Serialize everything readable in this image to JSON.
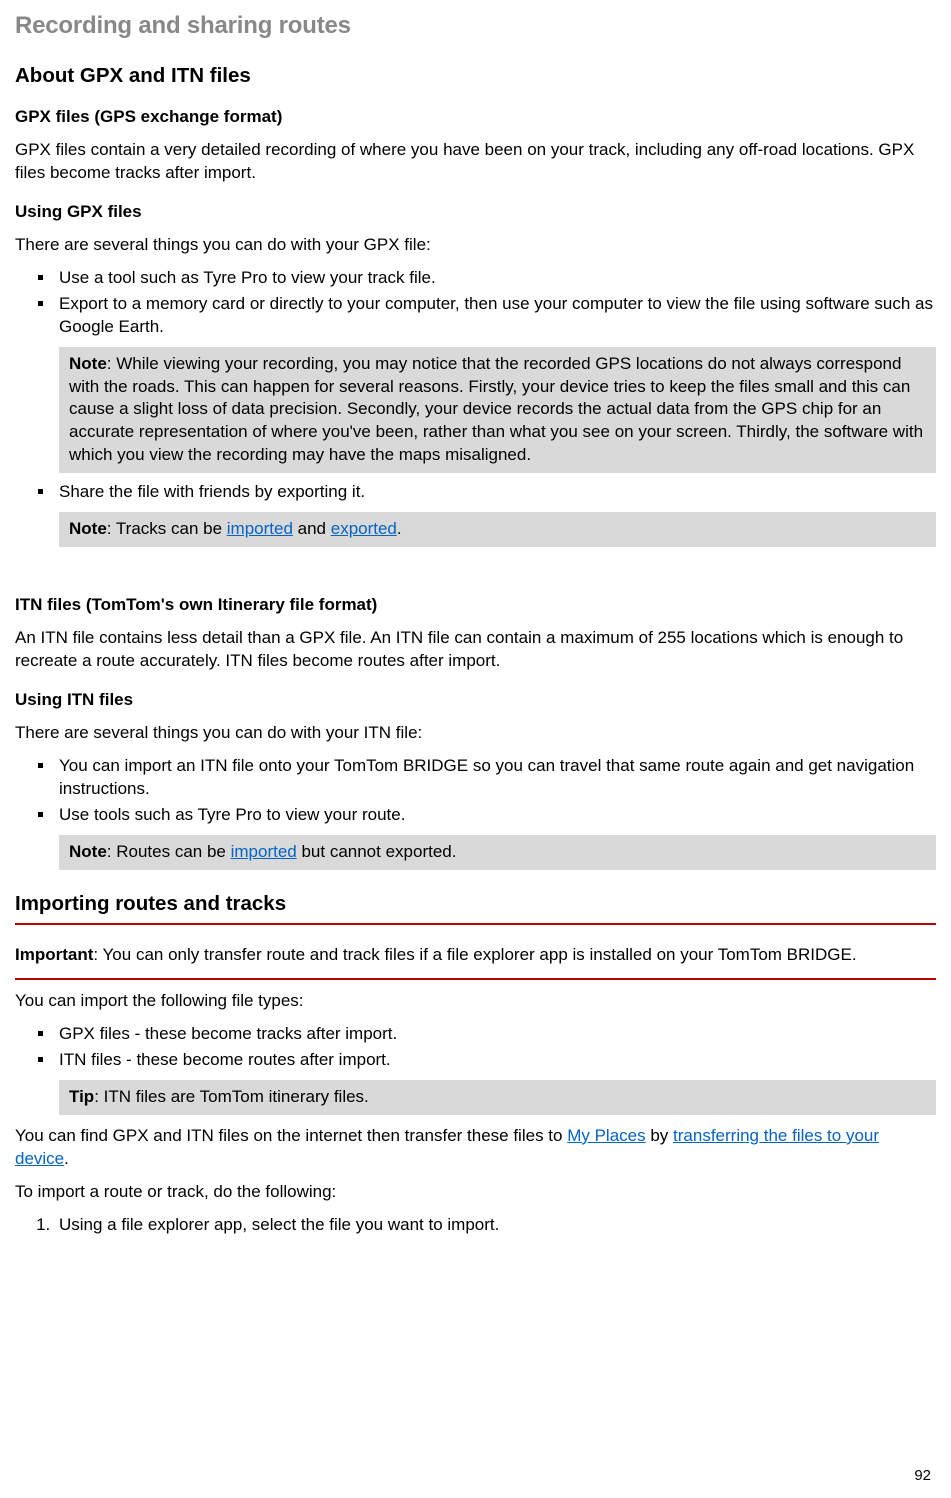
{
  "pageTitle": "Recording and sharing routes",
  "h2_about": "About GPX and ITN files",
  "gpx": {
    "heading": "GPX files (GPS exchange format)",
    "desc": "GPX files contain a very detailed recording of where you have been on your track, including any off-road locations. GPX files become tracks after import.",
    "using_h": "Using GPX files",
    "using_intro": "There are several things you can do with your GPX file:",
    "bullets": {
      "b1": "Use a tool such as Tyre Pro to view your track file.",
      "b2": "Export to a memory card or directly to your computer, then use your computer to view the file using software such as Google Earth.",
      "b3": "Share the file with friends by exporting it."
    },
    "note1_label": "Note",
    "note1_body": ": While viewing your recording, you may notice that the recorded GPS locations do not always correspond with the roads. This can happen for several reasons. Firstly, your device tries to keep the files small and this can cause a slight loss of data precision. Secondly, your device records the actual data from the GPS chip for an accurate representation of where you've been, rather than what you see on your screen. Thirdly, the software with which you view the recording may have the maps misaligned.",
    "note2_label": "Note",
    "note2_pre": ": Tracks can be ",
    "note2_link1": "imported",
    "note2_mid": " and ",
    "note2_link2": "exported",
    "note2_post": "."
  },
  "itn": {
    "heading": "ITN files (TomTom's own Itinerary file format)",
    "desc": "An ITN file contains less detail than a GPX file. An ITN file can contain a maximum of 255 locations which is enough to recreate a route accurately. ITN files become routes after import.",
    "using_h": "Using ITN files",
    "using_intro": "There are several things you can do with your ITN file:",
    "bullets": {
      "b1": "You can import an ITN file onto your TomTom BRIDGE so you can travel that same route again and get navigation instructions.",
      "b2": "Use tools such as Tyre Pro to view your route."
    },
    "note_label": "Note",
    "note_pre": ": Routes can be ",
    "note_link": "imported",
    "note_post": " but cannot exported."
  },
  "importing": {
    "heading": "Importing routes and tracks",
    "important_label": "Important",
    "important_body": ": You can only transfer route and track files if a file explorer app is installed on your TomTom BRIDGE.",
    "types_intro": "You can import the following file types:",
    "bullets": {
      "b1": "GPX files - these become tracks after import.",
      "b2": "ITN files - these become routes after import."
    },
    "tip_label": "Tip",
    "tip_body": ": ITN files are TomTom itinerary files.",
    "find_pre": "You can find GPX and ITN files on the internet then transfer these files to ",
    "find_link1": "My Places",
    "find_mid": " by ",
    "find_link2": "transferring the files to your device",
    "find_post": ".",
    "steps_intro": "To import a route or track, do the following:",
    "step1": "Using a file explorer app, select the file you want to import."
  },
  "pageNumber": "92"
}
